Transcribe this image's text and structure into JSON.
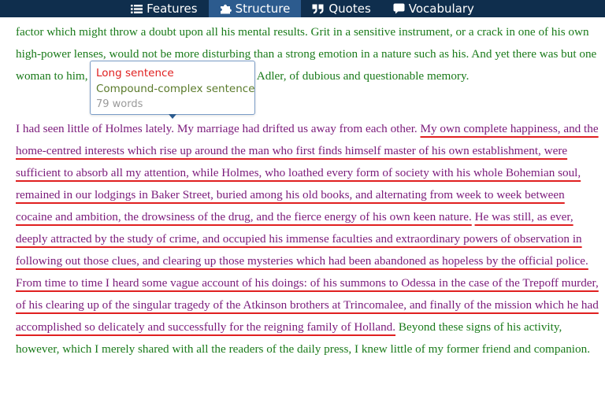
{
  "nav": {
    "tabs": [
      {
        "label": "Features",
        "icon": "list-icon"
      },
      {
        "label": "Structure",
        "icon": "puzzle-icon",
        "active": true
      },
      {
        "label": "Quotes",
        "icon": "quote-icon"
      },
      {
        "label": "Vocabulary",
        "icon": "speech-bubble-icon"
      }
    ]
  },
  "tooltip": {
    "kind": "Long sentence",
    "structure": "Compound-complex sentence",
    "word_count": "79 words"
  },
  "text": {
    "para1": "reasoner to admit such intrusions into his own delicate and finely adjusted temperament was to introduce a distracting factor which might throw a doubt upon all his mental results. Grit in a sensitive instrument, or a crack in one of his own high-power lenses, would not be more disturbing than a strong emotion in a nature such as his. And yet there was but one woman to him, and that woman was the late Irene Adler, of dubious and questionable memory.",
    "para2": {
      "s1": "I had seen little of Holmes lately. My marriage had drifted us away from each other.",
      "s2": "My own complete happiness, and the home-centred interests which rise up around the man who first finds himself master of his own establishment, were sufficient to absorb all my attention, while Holmes, who loathed every form of society with his whole Bohemian soul, remained in our lodgings in Baker Street, buried among his old books, and alternating from week to week between cocaine and ambition, the drowsiness of the drug, and the fierce energy of his own keen nature.",
      "s3": "He was still, as ever, deeply attracted by the study of crime, and occupied his immense faculties and extraordinary powers of observation in following out those clues, and clearing up those mysteries which had been abandoned as hopeless by the official police.",
      "s4": "From time to time I heard some vague account of his doings: of his summons to Odessa in the case of the Trepoff murder, of his clearing up of the singular tragedy of the Atkinson brothers at Trincomalee, and finally of the mission which he had accomplished so delicately and successfully for the reigning family of Holland.",
      "s5": "Beyond these signs of his activity, however, which I merely shared with all the readers of the daily press, I knew little of my former friend and companion."
    }
  },
  "colors": {
    "nav_bg": "#0f2e4d",
    "nav_active": "#2c5b8e",
    "text_green": "#1a7a1a",
    "text_purple": "#7a1a7a",
    "underline_red": "#e02020"
  }
}
